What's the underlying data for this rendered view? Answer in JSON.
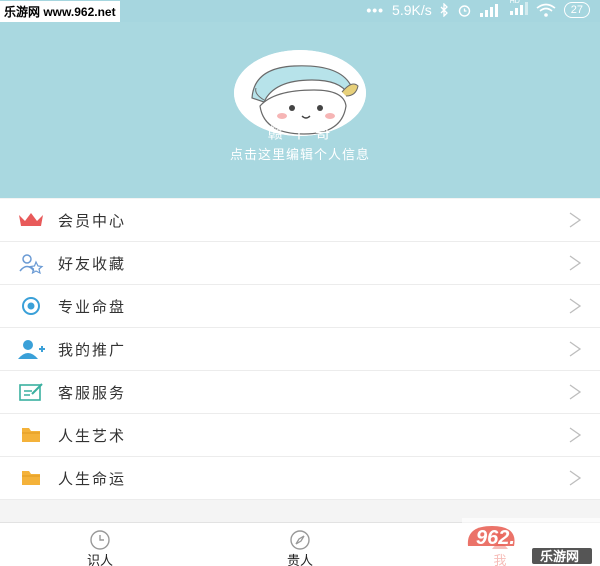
{
  "statusbar": {
    "watermark": "乐游网 www.962.net",
    "dots": "•••",
    "speed": "5.9K/s",
    "hd": "HD",
    "battery": "27"
  },
  "profile": {
    "name": "赣 丨 哥",
    "edit_hint": "点击这里编辑个人信息"
  },
  "menu": {
    "items": [
      {
        "label": "会员中心",
        "icon": "crown-icon",
        "color": "#e85a5a"
      },
      {
        "label": "好友收藏",
        "icon": "friends-icon",
        "color": "#6a9ad4"
      },
      {
        "label": "专业命盘",
        "icon": "eye-icon",
        "color": "#3aa0d8"
      },
      {
        "label": "我的推广",
        "icon": "add-user-icon",
        "color": "#3aa0d8"
      },
      {
        "label": "客服服务",
        "icon": "edit-icon",
        "color": "#3ab0a0"
      },
      {
        "label": "人生艺术",
        "icon": "folder-icon",
        "color": "#f4b23a"
      },
      {
        "label": "人生命运",
        "icon": "folder-icon",
        "color": "#f4b23a"
      }
    ]
  },
  "tabs": [
    {
      "label": "识人",
      "icon": "clock-icon"
    },
    {
      "label": "贵人",
      "icon": "compass-icon"
    },
    {
      "label": "我",
      "icon": "user-icon",
      "active_color": "#e85a4f"
    }
  ],
  "watermark_bottom": {
    "top": "962.NET",
    "bottom": "乐游网"
  }
}
